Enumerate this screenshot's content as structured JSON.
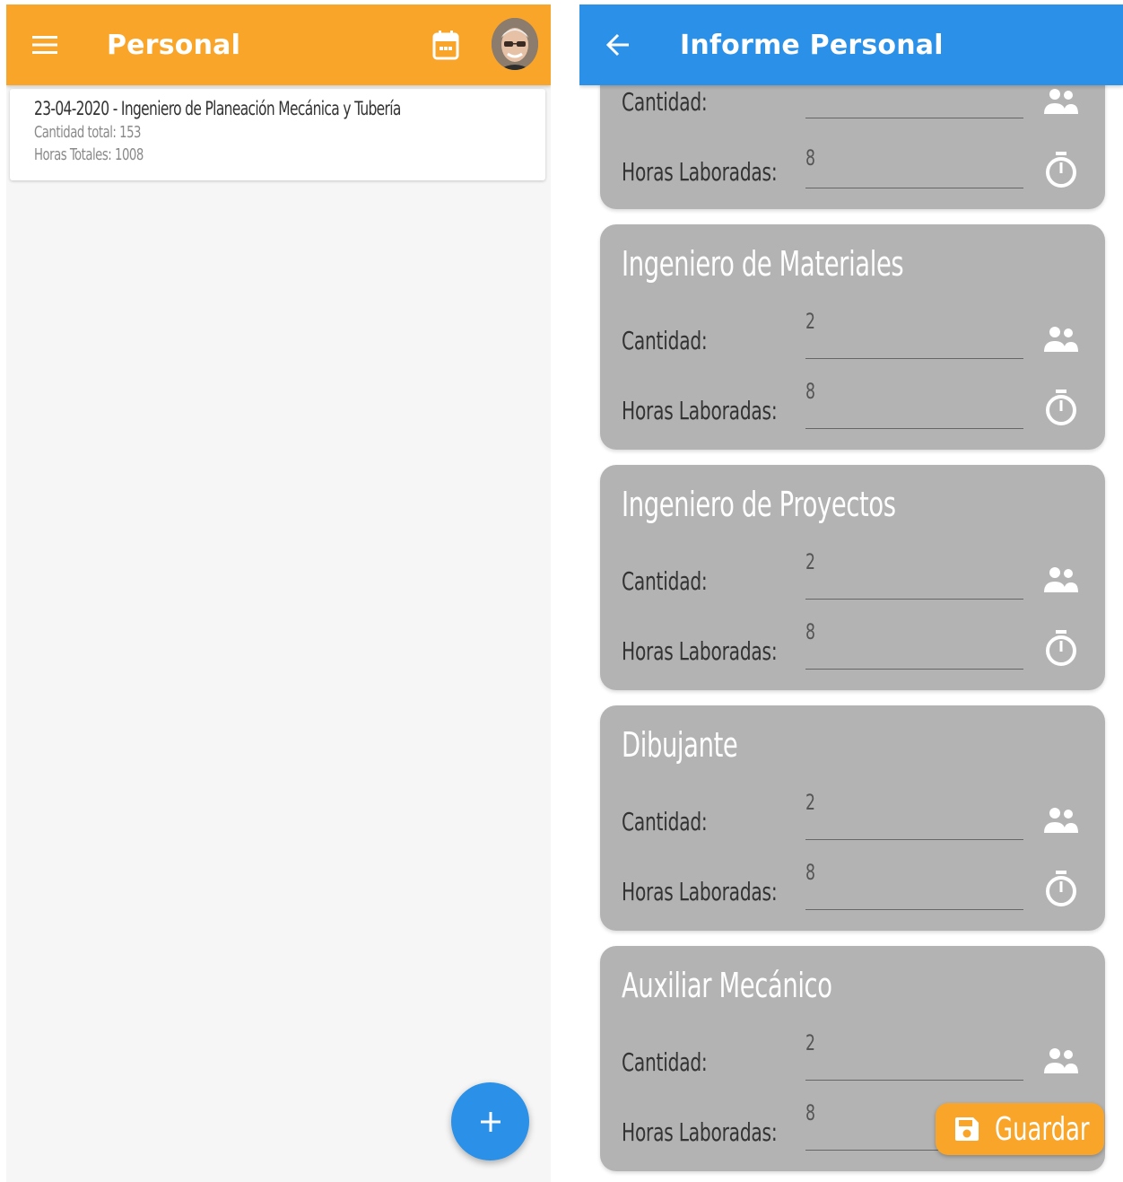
{
  "left": {
    "appbar": {
      "title": "Personal",
      "color": "#f9a529",
      "menu_icon": "menu-icon",
      "calendar_icon": "calendar-icon"
    },
    "list": [
      {
        "title": "23-04-2020 - Ingeniero de Planeación Mecánica y Tubería",
        "quantity": "Cantidad total: 153",
        "hours": "Horas Totales: 1008"
      }
    ],
    "fab": {
      "label": "+",
      "icon": "add-icon",
      "color": "#2a90e8"
    }
  },
  "right": {
    "appbar": {
      "title": "Informe Personal",
      "color": "#2a90e8",
      "back_icon": "arrow-back-icon"
    },
    "quantity_label": "Cantidad:",
    "hours_label": "Horas Laboradas:",
    "cards": [
      {
        "role": "",
        "quantity": "",
        "hours": "8"
      },
      {
        "role": "Ingeniero de Materiales",
        "quantity": "2",
        "hours": "8"
      },
      {
        "role": "Ingeniero de Proyectos",
        "quantity": "2",
        "hours": "8"
      },
      {
        "role": "Dibujante",
        "quantity": "2",
        "hours": "8"
      },
      {
        "role": "Auxiliar Mecánico",
        "quantity": "2",
        "hours": "8"
      }
    ],
    "save_button": {
      "label": "Guardar",
      "icon": "save-icon",
      "color": "#f9a529"
    }
  }
}
